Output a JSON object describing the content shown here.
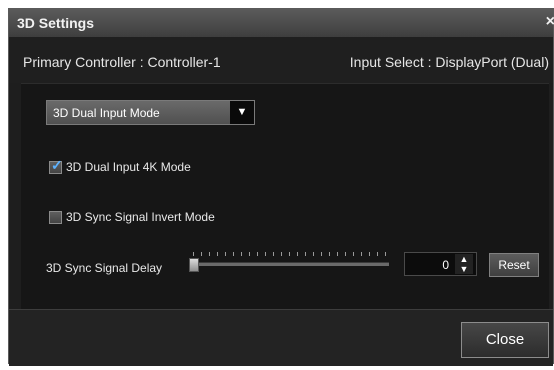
{
  "window": {
    "title": "3D Settings",
    "close_glyph": "×"
  },
  "info": {
    "primary_controller": "Primary Controller : Controller-1",
    "input_select": "Input Select : DisplayPort (Dual)"
  },
  "mode_select": {
    "value": "3D Dual Input Mode",
    "arrow_glyph": "▼"
  },
  "options": {
    "dual_input_4k": {
      "label": "3D Dual Input 4K Mode",
      "checked": true
    },
    "sync_invert": {
      "label": "3D Sync Signal Invert Mode",
      "checked": false
    }
  },
  "delay": {
    "label": "3D Sync Signal Delay",
    "value": "0",
    "slider_level": 0,
    "up_glyph": "▲",
    "down_glyph": "▼",
    "reset_label": "Reset"
  },
  "footer": {
    "close_label": "Close"
  },
  "icons": {
    "checkmark": "✓"
  },
  "colors": {
    "background": "#1e1e1e",
    "accent_check": "#5db2ff"
  }
}
